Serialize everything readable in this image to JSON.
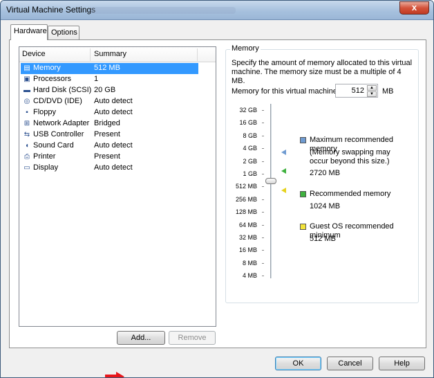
{
  "window": {
    "title": "Virtual Machine Settings",
    "close_label": "x"
  },
  "tabs": [
    {
      "label": "Hardware"
    },
    {
      "label": "Options"
    }
  ],
  "device_list": {
    "headers": {
      "device": "Device",
      "summary": "Summary"
    },
    "rows": [
      {
        "device": "Memory",
        "summary": "512 MB",
        "icon": "memory-icon"
      },
      {
        "device": "Processors",
        "summary": "1",
        "icon": "processor-icon"
      },
      {
        "device": "Hard Disk (SCSI)",
        "summary": "20 GB",
        "icon": "hard-disk-icon"
      },
      {
        "device": "CD/DVD (IDE)",
        "summary": "Auto detect",
        "icon": "cd-dvd-icon"
      },
      {
        "device": "Floppy",
        "summary": "Auto detect",
        "icon": "floppy-icon"
      },
      {
        "device": "Network Adapter",
        "summary": "Bridged",
        "icon": "network-adapter-icon"
      },
      {
        "device": "USB Controller",
        "summary": "Present",
        "icon": "usb-icon"
      },
      {
        "device": "Sound Card",
        "summary": "Auto detect",
        "icon": "sound-card-icon"
      },
      {
        "device": "Printer",
        "summary": "Present",
        "icon": "printer-icon"
      },
      {
        "device": "Display",
        "summary": "Auto detect",
        "icon": "display-icon"
      }
    ],
    "selected_index": 0
  },
  "list_buttons": {
    "add": "Add...",
    "remove": "Remove"
  },
  "memory": {
    "group_title": "Memory",
    "description": "Specify the amount of memory allocated to this virtual machine. The memory size must be a multiple of 4 MB.",
    "field_label": "Memory for this virtual machine:",
    "value": "512",
    "unit": "MB",
    "scale_labels": [
      "32 GB",
      "16 GB",
      "8 GB",
      "4 GB",
      "2 GB",
      "1 GB",
      "512 MB",
      "256 MB",
      "128 MB",
      "64 MB",
      "32 MB",
      "16 MB",
      "8 MB",
      "4 MB"
    ],
    "legend": {
      "max": {
        "title": "Maximum recommended memory",
        "note": "(Memory swapping may occur beyond this size.)",
        "value": "2720 MB",
        "color": "#6f9bd1"
      },
      "recommended": {
        "title": "Recommended memory",
        "value": "1024 MB",
        "color": "#3fb13f"
      },
      "guest_min": {
        "title": "Guest OS recommended minimum",
        "value": "512 MB",
        "color": "#f2e33a"
      }
    }
  },
  "footer": {
    "ok": "OK",
    "cancel": "Cancel",
    "help": "Help"
  }
}
